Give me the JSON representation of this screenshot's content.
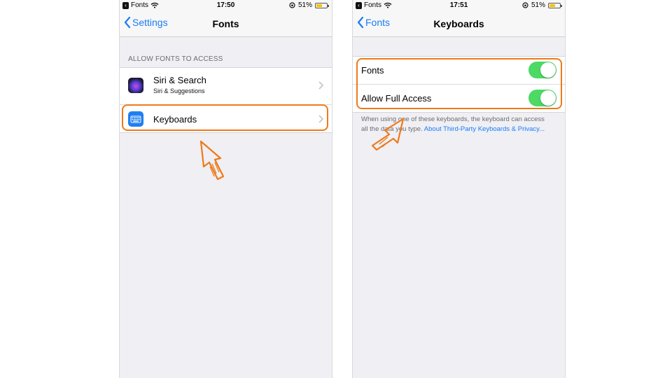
{
  "left": {
    "status": {
      "back_app": "Fonts",
      "time": "17:50",
      "battery": "51%"
    },
    "nav": {
      "back_label": "Settings",
      "title": "Fonts"
    },
    "section_header": "ALLOW FONTS TO ACCESS",
    "rows": [
      {
        "title": "Siri & Search",
        "subtitle": "Siri & Suggestions",
        "icon": "siri-icon"
      },
      {
        "title": "Keyboards",
        "icon": "keyboard-icon"
      }
    ]
  },
  "right": {
    "status": {
      "back_app": "Fonts",
      "time": "17:51",
      "battery": "51%"
    },
    "nav": {
      "back_label": "Fonts",
      "title": "Keyboards"
    },
    "toggles": [
      {
        "label": "Fonts",
        "state": "on"
      },
      {
        "label": "Allow Full Access",
        "state": "on"
      }
    ],
    "footnote": {
      "text": "When using one of these keyboards, the keyboard can access all the data you type.",
      "link": "About Third-Party Keyboards & Privacy..."
    }
  },
  "colors": {
    "accent": "#1a7cf5",
    "toggle_on": "#4cd964",
    "highlight": "#ee7a1a",
    "background": "#efeff4"
  }
}
